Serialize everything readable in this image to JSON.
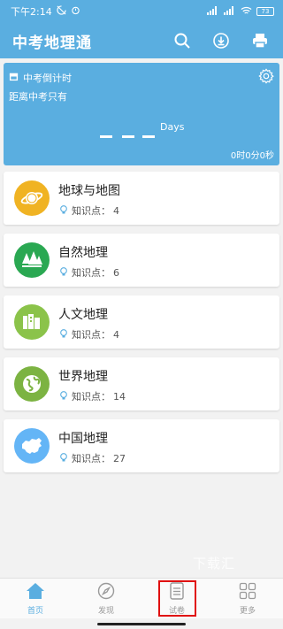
{
  "status_bar": {
    "time": "下午2:14",
    "battery": "73"
  },
  "app_bar": {
    "title": "中考地理通",
    "actions": [
      "search-icon",
      "download-icon",
      "print-icon"
    ]
  },
  "countdown": {
    "heading": "中考倒计时",
    "subtitle": "距离中考只有",
    "unit": "Days",
    "timer": "0时0分0秒"
  },
  "subjects": [
    {
      "name": "地球与地图",
      "kp_label": "知识点：",
      "kp_count": "4",
      "color": "#f0b323",
      "icon": "planet-icon"
    },
    {
      "name": "自然地理",
      "kp_label": "知识点：",
      "kp_count": "6",
      "color": "#2aa852",
      "icon": "forest-icon"
    },
    {
      "name": "人文地理",
      "kp_label": "知识点：",
      "kp_count": "4",
      "color": "#8bc34a",
      "icon": "buildings-icon"
    },
    {
      "name": "世界地理",
      "kp_label": "知识点：",
      "kp_count": "14",
      "color": "#7cb342",
      "icon": "globe-icon"
    },
    {
      "name": "中国地理",
      "kp_label": "知识点：",
      "kp_count": "27",
      "color": "#64b5f6",
      "icon": "china-map-icon"
    }
  ],
  "watermark": "下载汇",
  "bottom_nav": [
    {
      "label": "首页",
      "icon": "home-icon",
      "active": true
    },
    {
      "label": "发现",
      "icon": "compass-icon",
      "active": false
    },
    {
      "label": "试卷",
      "icon": "paper-icon",
      "active": false
    },
    {
      "label": "更多",
      "icon": "grid-icon",
      "active": false
    }
  ],
  "colors": {
    "primary": "#5aaee0",
    "highlight": "#e01010"
  }
}
